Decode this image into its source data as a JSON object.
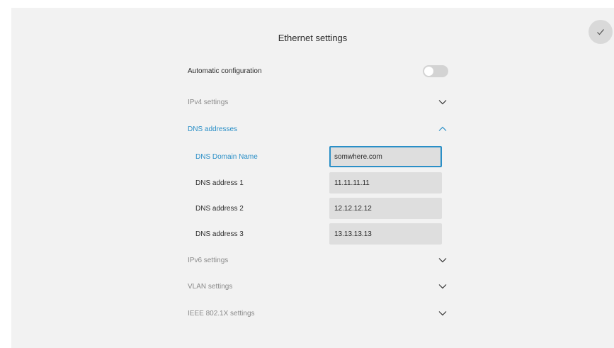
{
  "header": {
    "title": "Ethernet settings"
  },
  "auto_config": {
    "label": "Automatic configuration",
    "enabled": false
  },
  "sections": {
    "ipv4": {
      "label": "IPv4 settings",
      "expanded": false
    },
    "dns": {
      "label": "DNS addresses",
      "expanded": true
    },
    "ipv6": {
      "label": "IPv6 settings",
      "expanded": false
    },
    "vlan": {
      "label": "VLAN settings",
      "expanded": false
    },
    "ieee": {
      "label": "IEEE 802.1X settings",
      "expanded": false
    }
  },
  "dns_fields": {
    "domain": {
      "label": "DNS Domain Name",
      "value": "somwhere.com"
    },
    "address1": {
      "label": "DNS address 1",
      "value": "11.11.11.11"
    },
    "address2": {
      "label": "DNS address 2",
      "value": "12.12.12.12"
    },
    "address3": {
      "label": "DNS address 3",
      "value": "13.13.13.13"
    }
  },
  "colors": {
    "accent": "#2a8fc7",
    "panel_bg": "#f2f2f2",
    "field_bg": "#dedede"
  }
}
